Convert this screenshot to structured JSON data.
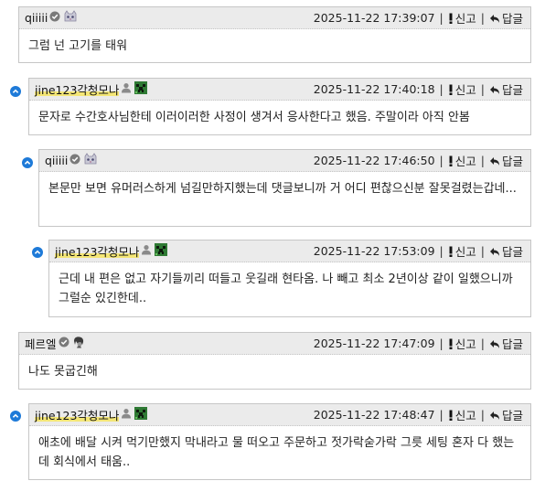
{
  "labels": {
    "report": "신고",
    "reply": "답글"
  },
  "comments": [
    {
      "author": "qiiiii",
      "time": "2025-11-22 17:39:07",
      "text": "그럼 넌 고기를 태워"
    },
    {
      "author": "jine123각청모나",
      "time": "2025-11-22 17:40:18",
      "text": "문자로 수간호사님한테 이러이러한 사정이 생겨서 응사한다고 했음. 주말이라 아직 안봄"
    },
    {
      "author": "qiiiii",
      "time": "2025-11-22 17:46:50",
      "text": "본문만 보면 유머러스하게 넘길만하지했는데 댓글보니까 거 어디 편찮으신분 잘못걸렸는갑네..."
    },
    {
      "author": "jine123각청모나",
      "time": "2025-11-22 17:53:09",
      "text": "근데 내 편은 없고 자기들끼리 떠들고 웃길래 현타옴. 나 빼고 최소 2년이상 같이 일했으니까 그럴순 있긴한데.."
    },
    {
      "author": "페르엘",
      "time": "2025-11-22 17:47:09",
      "text": "나도 못굽긴해"
    },
    {
      "author": "jine123각청모나",
      "time": "2025-11-22 17:48:47",
      "text": "애초에 배달 시켜 먹기만했지 막내라고 물 떠오고 주문하고 젓가락숟가락 그릇 세팅 혼자 다 했는데 회식에서 태움.."
    }
  ]
}
